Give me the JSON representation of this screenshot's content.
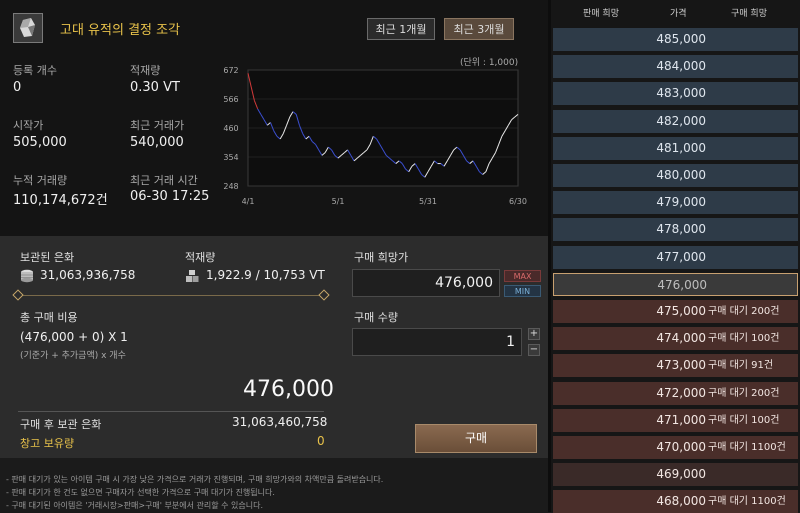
{
  "item": {
    "name": "고대 유적의 결정 조각"
  },
  "period_buttons": {
    "one_month": "최근 1개월",
    "three_months": "최근 3개월"
  },
  "stats": {
    "registered_label": "등록 개수",
    "registered_value": "0",
    "loadage_label": "적재량",
    "loadage_value": "0.30 VT",
    "start_price_label": "시작가",
    "start_price_value": "505,000",
    "recent_price_label": "최근 거래가",
    "recent_price_value": "540,000",
    "total_trades_label": "누적 거래량",
    "total_trades_value": "110,174,672건",
    "recent_time_label": "최근 거래 시간",
    "recent_time_value": "06-30 17:25"
  },
  "chart_data": {
    "type": "line",
    "unit_note": "(단위 : 1,000)",
    "y_ticks": [
      "672",
      "566",
      "460",
      "354",
      "248"
    ],
    "x_ticks": [
      "4/1",
      "5/1",
      "5/31",
      "6/30"
    ],
    "ylim": [
      248,
      672
    ],
    "grid": true,
    "series": [
      {
        "values": [
          660,
          610,
          560,
          530,
          510,
          490,
          470,
          480,
          450,
          430,
          420,
          440,
          470,
          500,
          520,
          510,
          470,
          440,
          420,
          430,
          410,
          400,
          380,
          360,
          370,
          390,
          380,
          360,
          350,
          360,
          370,
          380,
          360,
          340,
          350,
          360,
          370,
          380,
          400,
          430,
          420,
          400,
          380,
          360,
          350,
          340,
          330,
          340,
          330,
          310,
          300,
          320,
          330,
          310,
          290,
          280,
          300,
          320,
          340,
          330,
          330,
          320,
          340,
          360,
          380,
          390,
          380,
          360,
          340,
          330,
          340,
          320,
          300,
          290,
          300,
          330,
          350,
          370,
          400,
          430,
          450,
          470,
          490,
          500,
          510
        ],
        "colors": {
          "up": "#e8e8e8",
          "down": "#3b4fd0",
          "start": "#d23a3a"
        }
      }
    ]
  },
  "holdings": {
    "silver_label": "보관된 은화",
    "silver_value": "31,063,936,758",
    "weight_label": "적재량",
    "weight_value": "1,922.9 / 10,753 VT"
  },
  "purchase": {
    "cost_label": "총 구매 비용",
    "formula": "(476,000 + 0) X 1",
    "formula_note": "(기준가 + 추가금액) x 개수",
    "total": "476,000",
    "after_label": "구매 후 보관 은화",
    "after_value": "31,063,460,758",
    "storage_label": "창고 보유량",
    "storage_value": "0",
    "price_label": "구매 희망가",
    "price_value": "476,000",
    "max_label": "MAX",
    "min_label": "MIN",
    "qty_label": "구매 수량",
    "qty_value": "1",
    "plus": "+",
    "minus": "−",
    "buy_label": "구매"
  },
  "notes": [
    "- 판매 대기가 있는 아이템 구매 시 가장 낮은 가격으로 거래가 진행되며, 구매 희망가와의 차액만큼 돌려받습니다.",
    "- 판매 대기가 한 건도 없으면 구매자가 선택한 가격으로 구매 대기가 진행됩니다.",
    "- 구매 대기된 아이템은 '거래시장>판매>구매' 부분에서 관리할 수 있습니다."
  ],
  "orderbook": {
    "headers": [
      "판매 희망",
      "가격",
      "구매 희망"
    ],
    "rows": [
      {
        "price": "485,000",
        "wait": "",
        "type": "sell"
      },
      {
        "price": "484,000",
        "wait": "",
        "type": "sell"
      },
      {
        "price": "483,000",
        "wait": "",
        "type": "sell"
      },
      {
        "price": "482,000",
        "wait": "",
        "type": "sell"
      },
      {
        "price": "481,000",
        "wait": "",
        "type": "sell"
      },
      {
        "price": "480,000",
        "wait": "",
        "type": "sell"
      },
      {
        "price": "479,000",
        "wait": "",
        "type": "sell"
      },
      {
        "price": "478,000",
        "wait": "",
        "type": "sell"
      },
      {
        "price": "477,000",
        "wait": "",
        "type": "sell"
      },
      {
        "price": "476,000",
        "wait": "",
        "type": "current"
      },
      {
        "price": "475,000",
        "wait": "구매 대기 200건",
        "type": "buy"
      },
      {
        "price": "474,000",
        "wait": "구매 대기 100건",
        "type": "buy"
      },
      {
        "price": "473,000",
        "wait": "구매 대기 91건",
        "type": "buy"
      },
      {
        "price": "472,000",
        "wait": "구매 대기 200건",
        "type": "buy"
      },
      {
        "price": "471,000",
        "wait": "구매 대기 100건",
        "type": "buy"
      },
      {
        "price": "470,000",
        "wait": "구매 대기 1100건",
        "type": "buy"
      },
      {
        "price": "469,000",
        "wait": "",
        "type": "empty"
      },
      {
        "price": "468,000",
        "wait": "구매 대기 1100건",
        "type": "buy"
      }
    ]
  }
}
